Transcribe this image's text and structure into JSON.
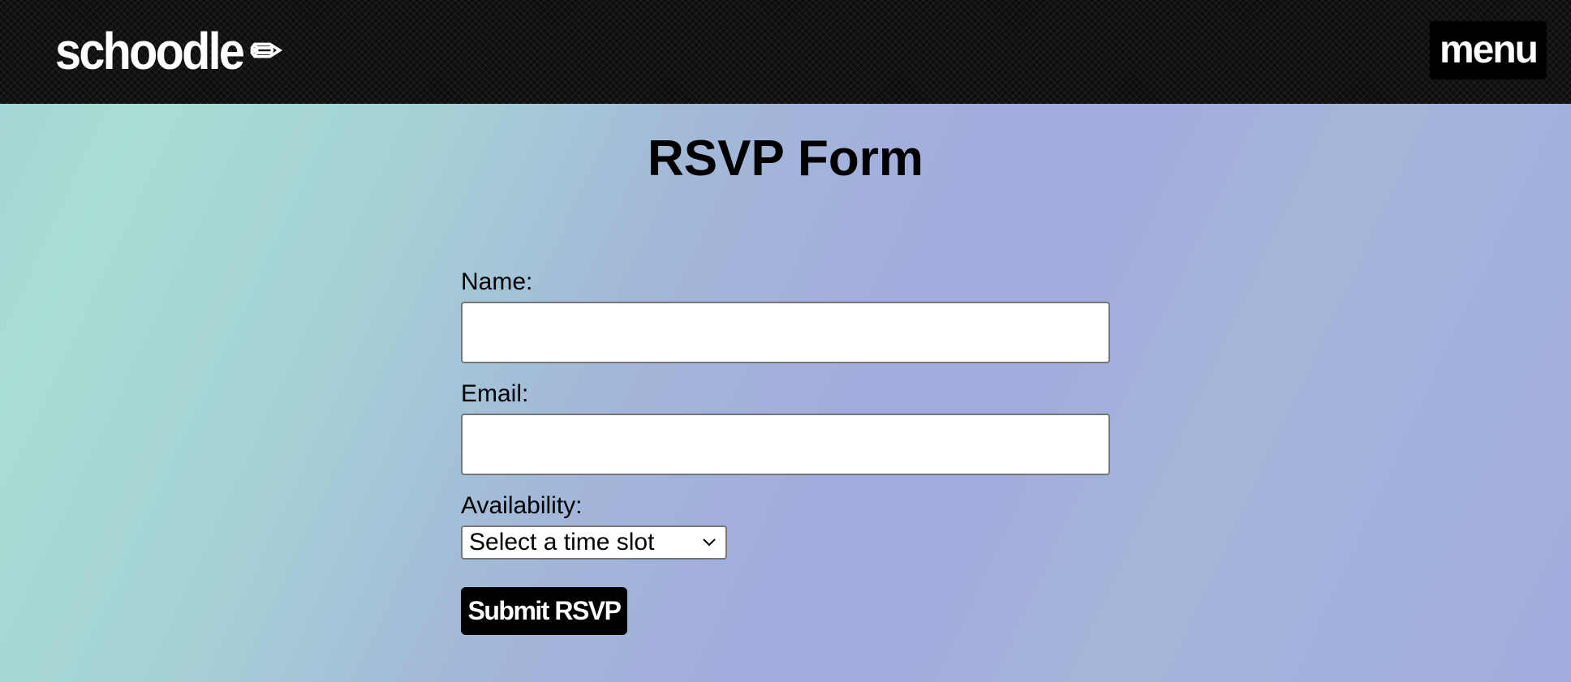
{
  "header": {
    "brand": "schoodle",
    "brand_icon": "✏",
    "menu_label": "menu"
  },
  "page": {
    "title": "RSVP Form"
  },
  "form": {
    "name_label": "Name:",
    "name_value": "",
    "email_label": "Email:",
    "email_value": "",
    "availability_label": "Availability:",
    "availability_selected": "Select a time slot",
    "submit_label": "Submit RSVP"
  },
  "colors": {
    "topbar_bg": "#0d0d0d",
    "button_bg": "#000000",
    "gradient_teal": "#a8ddd4",
    "gradient_lavender": "#a2acdc"
  }
}
